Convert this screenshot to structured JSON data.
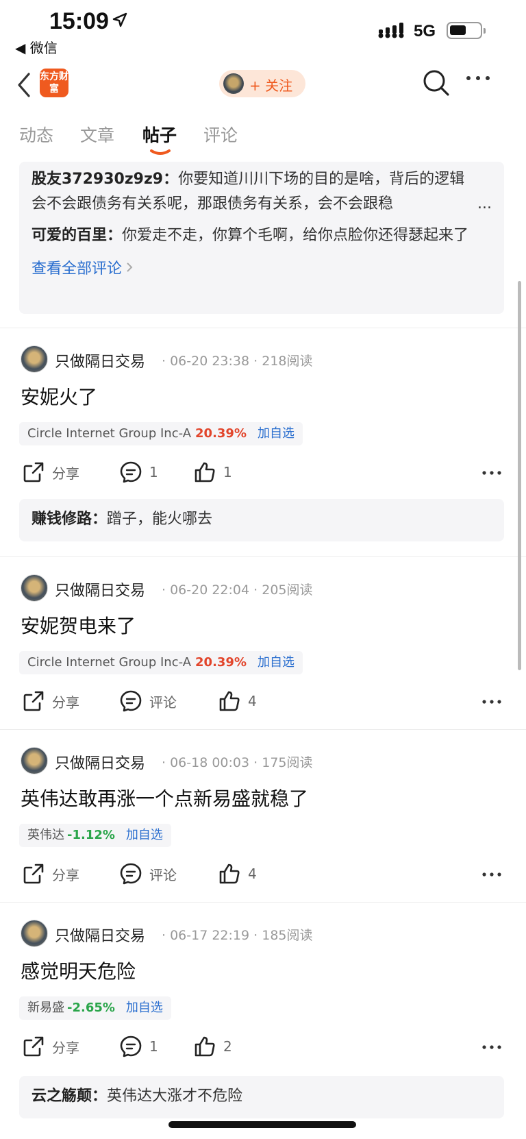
{
  "status_bar": {
    "time": "15:09",
    "back_app": "◀ 微信",
    "network": "5G"
  },
  "header": {
    "logo_text": "东方财富",
    "follow_label": "+ 关注"
  },
  "tabs": [
    {
      "label": "动态",
      "active": false
    },
    {
      "label": "文章",
      "active": false
    },
    {
      "label": "帖子",
      "active": true
    },
    {
      "label": "评论",
      "active": false
    }
  ],
  "top_comments": {
    "comments": [
      {
        "user": "股友372930z9z9",
        "text": "你要知道川川下场的目的是啥，背后的逻辑会不会跟债务有关系呢，那跟债务有关系，会不会跟稳",
        "ellipsis": "..."
      },
      {
        "user": "可爱的百里",
        "text": "你爱走不走，你算个毛啊，给你点脸你还得瑟起来了"
      }
    ],
    "view_all": "查看全部评论"
  },
  "posts": [
    {
      "author": "只做隔日交易",
      "date": "06-20 23:38",
      "reads": "218阅读",
      "title": "安妮火了",
      "stock": {
        "name": "Circle Internet Group Inc-A",
        "change": "20.39%",
        "dir": "up",
        "add": "加自选"
      },
      "share": "分享",
      "comments": "1",
      "likes": "1",
      "reply": {
        "user": "赚钱修路",
        "text": "蹭子，能火哪去"
      }
    },
    {
      "author": "只做隔日交易",
      "date": "06-20 22:04",
      "reads": "205阅读",
      "title": "安妮贺电来了",
      "stock": {
        "name": "Circle Internet Group Inc-A",
        "change": "20.39%",
        "dir": "up",
        "add": "加自选"
      },
      "share": "分享",
      "comments": "评论",
      "likes": "4"
    },
    {
      "author": "只做隔日交易",
      "date": "06-18 00:03",
      "reads": "175阅读",
      "title": "英伟达敢再涨一个点新易盛就稳了",
      "stock": {
        "name": "英伟达",
        "change": "-1.12%",
        "dir": "down",
        "add": "加自选"
      },
      "share": "分享",
      "comments": "评论",
      "likes": "4"
    },
    {
      "author": "只做隔日交易",
      "date": "06-17 22:19",
      "reads": "185阅读",
      "title": "感觉明天危险",
      "stock": {
        "name": "新易盛",
        "change": "-2.65%",
        "dir": "down",
        "add": "加自选"
      },
      "share": "分享",
      "comments": "1",
      "likes": "2",
      "reply": {
        "user": "云之觞颠",
        "text": "英伟达大涨才不危险"
      }
    }
  ],
  "colors": {
    "accent": "#ef5a1f",
    "link": "#2b6fcf",
    "up": "#e2452b",
    "down": "#2aa54a"
  },
  "icons": [
    "back-icon",
    "search-icon",
    "more-icon",
    "share-icon",
    "comment-icon",
    "like-icon"
  ]
}
